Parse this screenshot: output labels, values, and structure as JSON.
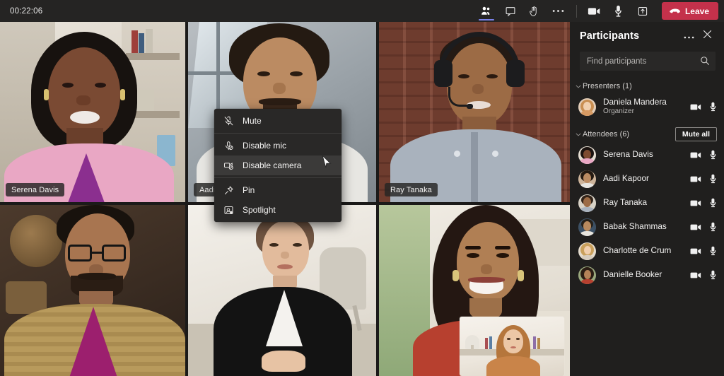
{
  "meeting": {
    "timer": "00:22:06"
  },
  "toolbar": {
    "people_label": "People",
    "chat_label": "Chat",
    "raise_hand_label": "Raise hand",
    "more_label": "More actions",
    "camera_label": "Camera",
    "mic_label": "Microphone",
    "share_label": "Share content",
    "leave_label": "Leave",
    "leave_color": "#c4314b",
    "active_accent": "#7b83eb"
  },
  "stage": {
    "tiles": [
      {
        "name": "Serena Davis",
        "has_more": false
      },
      {
        "name": "Aadi Kapoor",
        "has_more": true
      },
      {
        "name": "Ray Tanaka",
        "has_more": false
      },
      {
        "name": "",
        "has_more": false
      },
      {
        "name": "",
        "has_more": false
      },
      {
        "name": "",
        "has_more": false
      }
    ],
    "self_view_name": "Daniela Mandera"
  },
  "context_menu": {
    "items": [
      {
        "label": "Mute",
        "icon": "mic-muted-icon",
        "hovered": false
      },
      {
        "label": "Disable mic",
        "icon": "mic-disable-icon",
        "hovered": false
      },
      {
        "label": "Disable camera",
        "icon": "camera-disable-icon",
        "hovered": true
      },
      {
        "label": "Pin",
        "icon": "pin-icon",
        "hovered": false
      },
      {
        "label": "Spotlight",
        "icon": "spotlight-icon",
        "hovered": false
      }
    ]
  },
  "panel": {
    "title": "Participants",
    "more_label": "More options",
    "close_label": "Close",
    "search": {
      "placeholder": "Find participants"
    },
    "sections": [
      {
        "label": "Presenters (1)",
        "has_mute_all": false,
        "mute_all_label": "",
        "people": [
          {
            "name": "Daniela Mandera",
            "role": "Organizer",
            "avatar": "#c98f6a"
          }
        ]
      },
      {
        "label": "Attendees (6)",
        "has_mute_all": true,
        "mute_all_label": "Mute all",
        "people": [
          {
            "name": "Serena Davis",
            "role": "",
            "avatar": "#7a4a33"
          },
          {
            "name": "Aadi Kapoor",
            "role": "",
            "avatar": "#8a5a3a"
          },
          {
            "name": "Ray Tanaka",
            "role": "",
            "avatar": "#6d5544"
          },
          {
            "name": "Babak Shammas",
            "role": "",
            "avatar": "#4b6377"
          },
          {
            "name": "Charlotte de Crum",
            "role": "",
            "avatar": "#bd8b63"
          },
          {
            "name": "Danielle Booker",
            "role": "",
            "avatar": "#4f6b4a"
          }
        ]
      }
    ],
    "row_icons": {
      "camera": "camera-icon",
      "mic": "microphone-icon"
    }
  }
}
